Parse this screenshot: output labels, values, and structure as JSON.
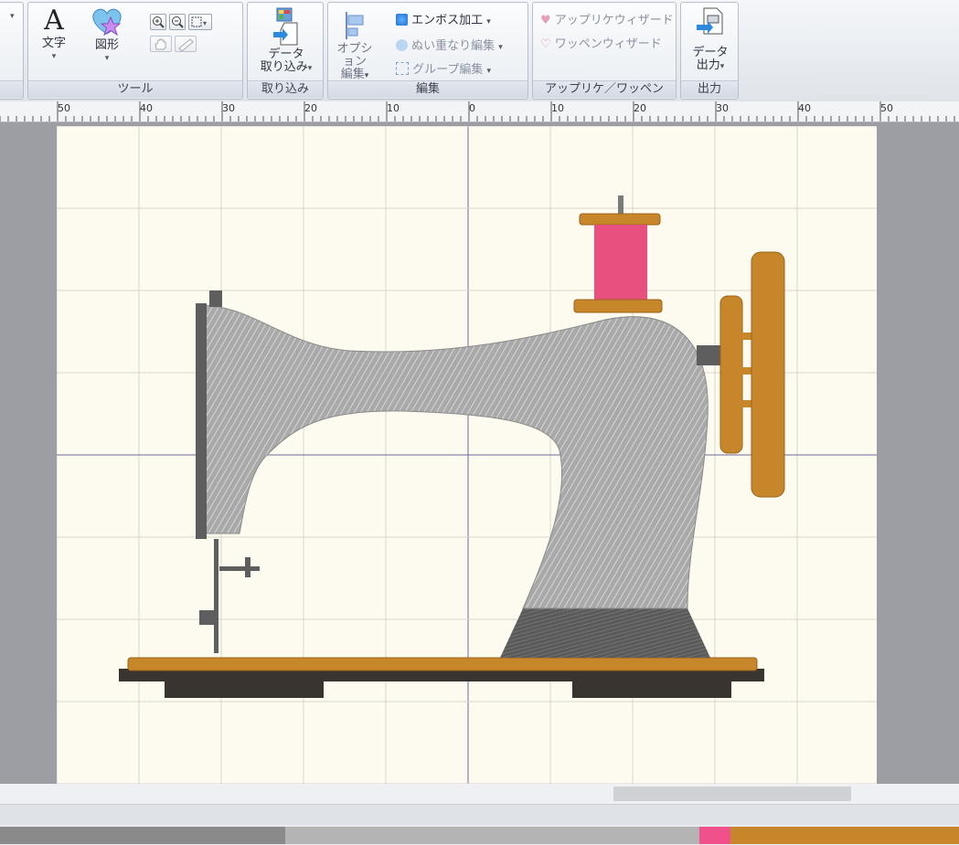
{
  "ribbon": {
    "groups": {
      "tools": {
        "label": "ツール",
        "text_button": "文字",
        "shape_button": "図形"
      },
      "import": {
        "label": "取り込み",
        "data_import_line1": "データ",
        "data_import_line2": "取り込み"
      },
      "edit": {
        "label": "編集",
        "option_line1": "オプション",
        "option_line2": "編集",
        "emboss": "エンボス加工",
        "stitch_overlap": "ぬい重なり編集",
        "group_edit": "グループ編集"
      },
      "applique": {
        "label": "アップリケ／ワッペン",
        "applique_wizard": "アップリケウィザード",
        "patch_wizard": "ワッペンウィザード"
      },
      "output": {
        "label": "出力",
        "data_output_line1": "データ",
        "data_output_line2": "出力"
      }
    }
  },
  "ruler": {
    "labels": [
      "50",
      "40",
      "30",
      "20",
      "10",
      "0",
      "10",
      "20",
      "30",
      "40",
      "50"
    ]
  },
  "thread_colors": [
    "#8a8a8a",
    "#b4b4b4",
    "#f0508c",
    "#c8862a"
  ],
  "colors": {
    "canvas": "#fdfaf0",
    "grid": "#d9d5cc",
    "axis": "#6d6a9a",
    "body_gray": "#a8a8a8",
    "dark_gray": "#5e5e5e",
    "wood": "#c8862a",
    "spool_pink": "#e8507f",
    "base_dark": "#3a3430"
  }
}
